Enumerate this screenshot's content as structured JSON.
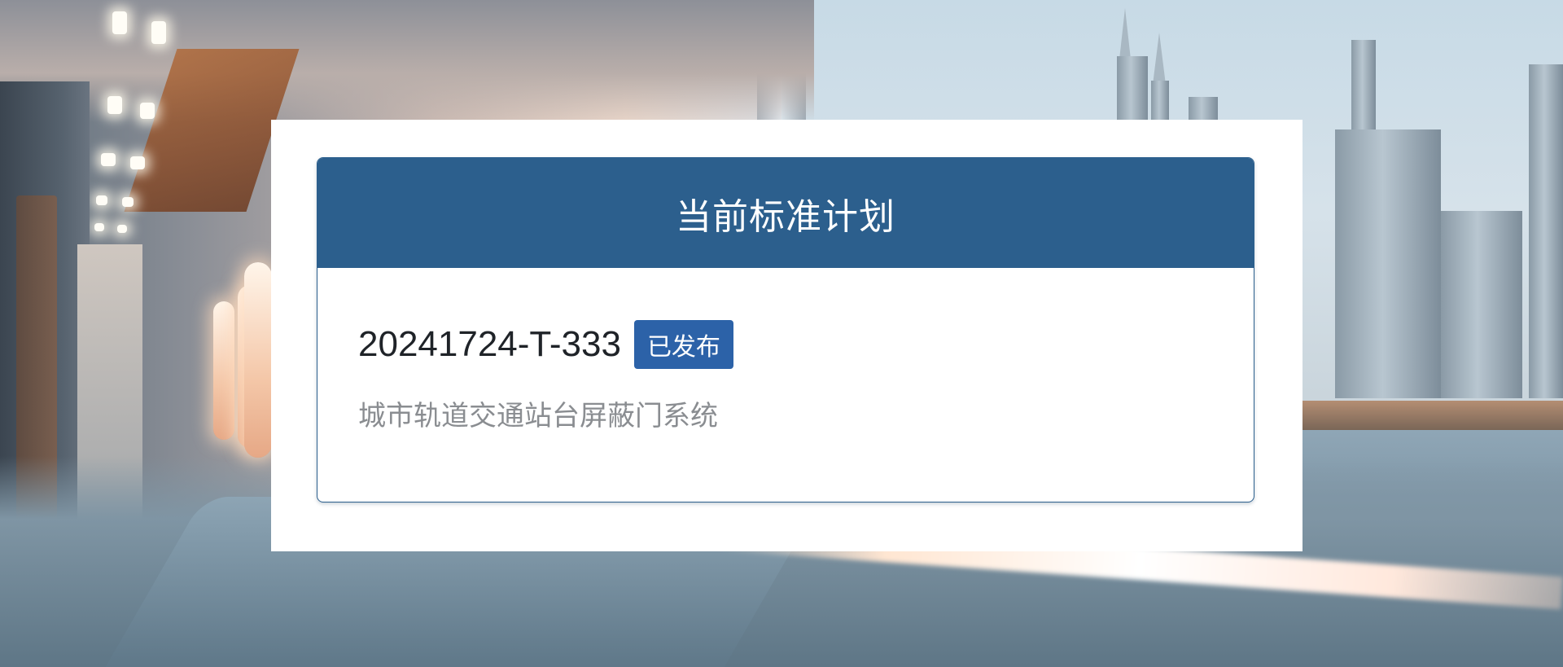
{
  "background": {
    "description_icon": "train-interior-city-view"
  },
  "card": {
    "title": "当前标准计划",
    "plan_id": "20241724-T-333",
    "status": "已发布",
    "description": "城市轨道交通站台屏蔽门系统"
  },
  "colors": {
    "header": "#2c5f8d",
    "badge": "#2c62a8",
    "description_text": "#8a8d91",
    "id_text": "#1f2328"
  }
}
